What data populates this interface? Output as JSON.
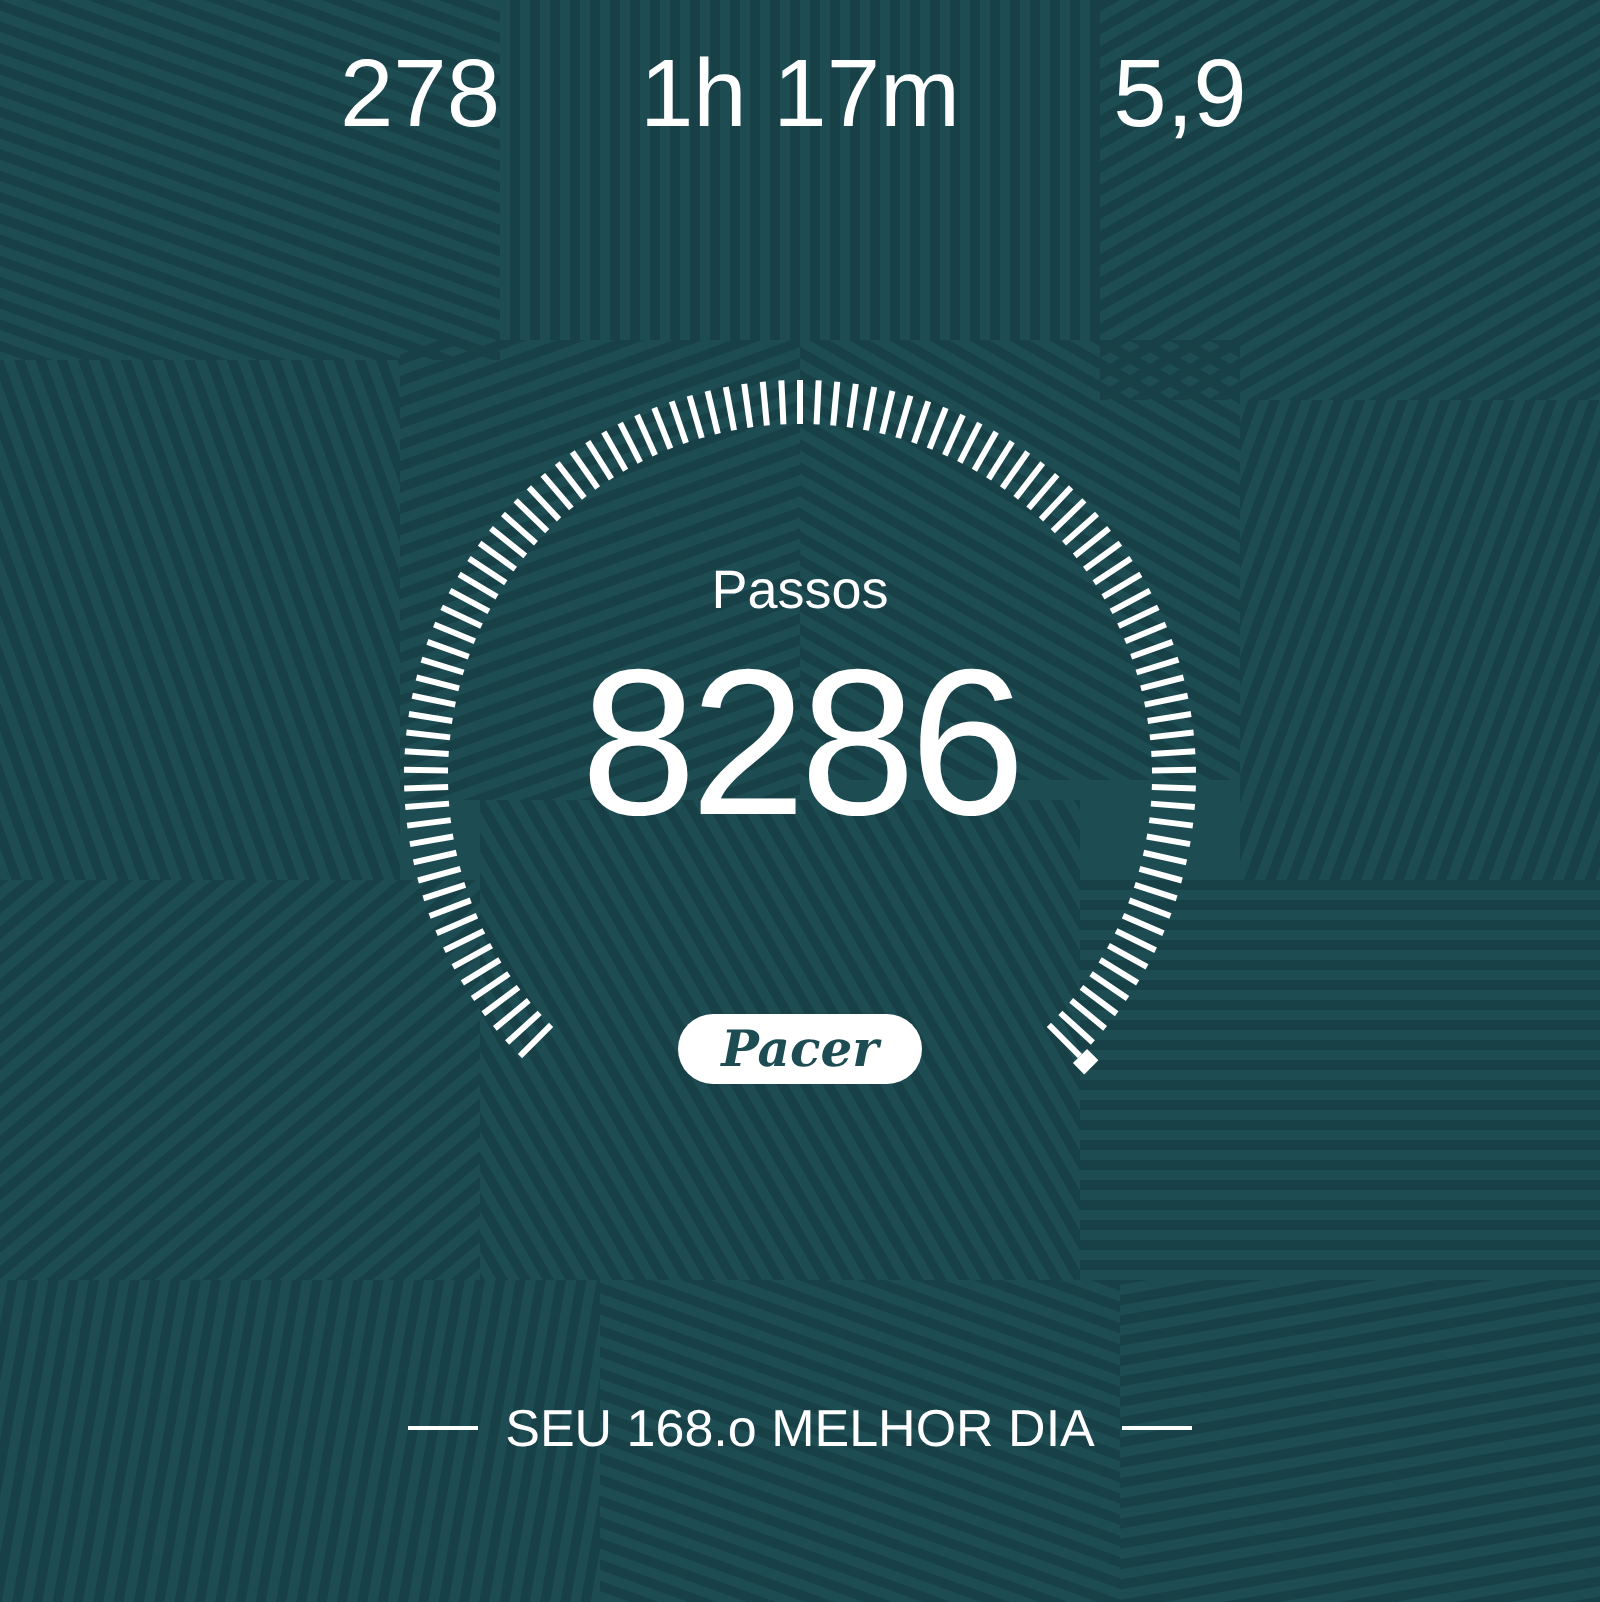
{
  "stats": [
    {
      "value": "278"
    },
    {
      "value": "1h 17m"
    },
    {
      "value": "5,9"
    }
  ],
  "gauge": {
    "label": "Passos",
    "value": "8286"
  },
  "logo": "Pacer",
  "rank": "SEU 168.o MELHOR DIA"
}
